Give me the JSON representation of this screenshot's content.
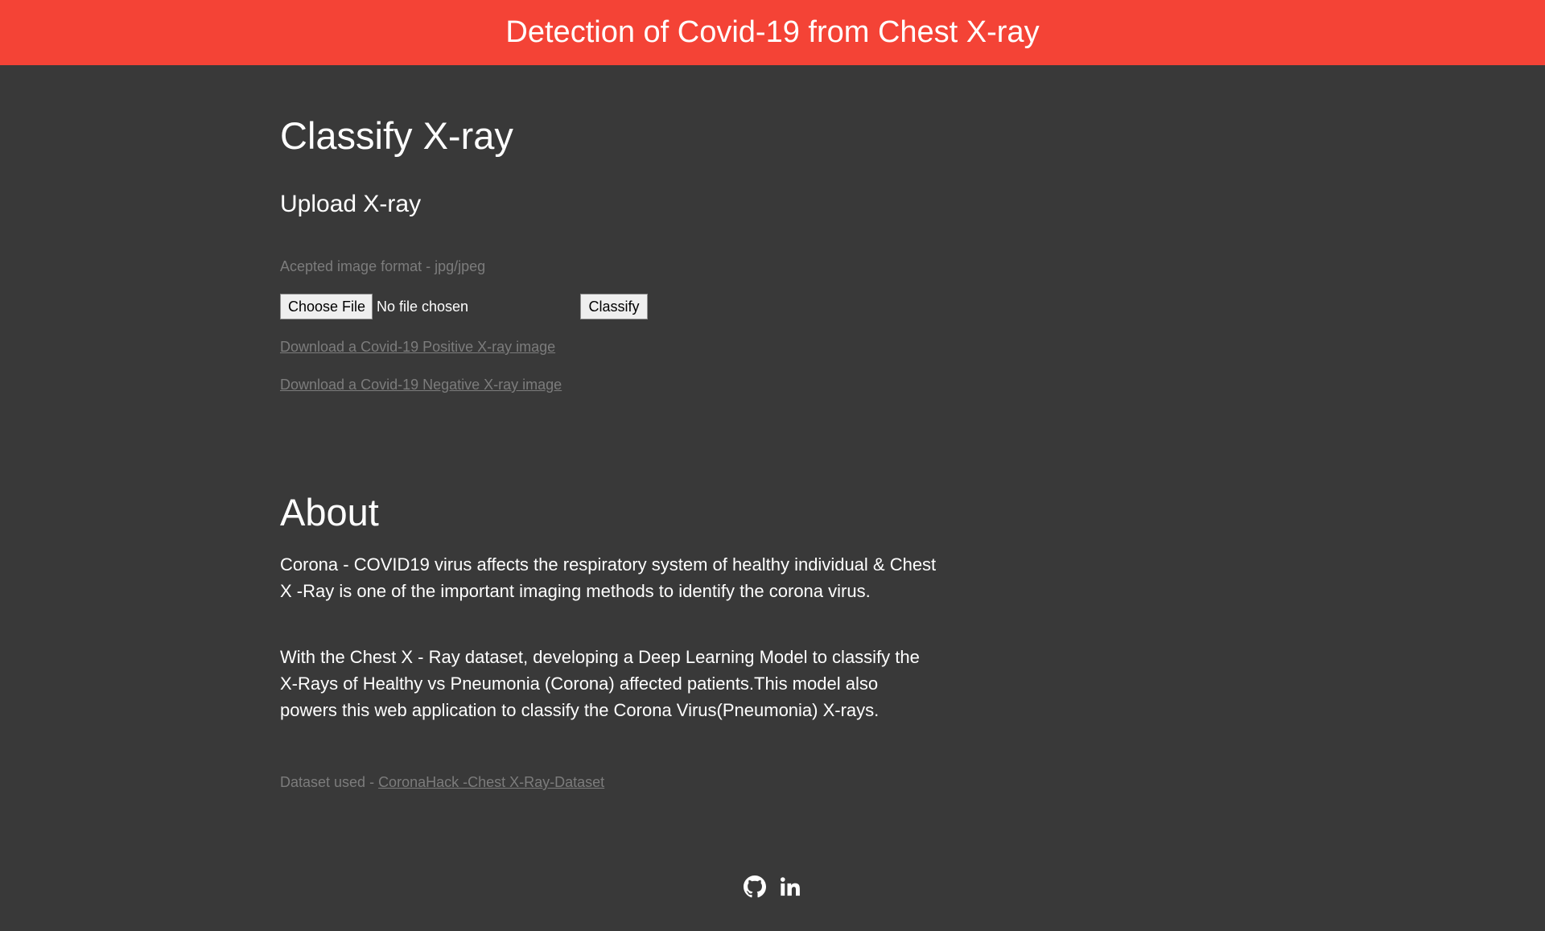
{
  "header": {
    "title": "Detection of Covid-19 from Chest X-ray",
    "bg_color": "#f44336"
  },
  "classify": {
    "heading": "Classify X-ray",
    "subheading": "Upload X-ray",
    "format_note": "Acepted image format - jpg/jpeg",
    "choose_file_label": "Choose File",
    "file_status": "No file chosen",
    "classify_button": "Classify",
    "download_positive": "Download a Covid-19 Positive X-ray image",
    "download_negative": "Download a Covid-19 Negative X-ray image"
  },
  "about": {
    "heading": "About",
    "paragraph1": "Corona - COVID19 virus affects the respiratory system of healthy individual & Chest X -Ray is one of the important imaging methods to identify the corona virus.",
    "paragraph2": "With the Chest X - Ray dataset, developing a Deep Learning Model to classify the X-Rays of Healthy vs Pneumonia (Corona) affected patients.This model also powers this web application to classify the Corona Virus(Pneumonia) X-rays.",
    "dataset_prefix": "Dataset used - ",
    "dataset_link": "CoronaHack -Chest X-Ray-Dataset"
  },
  "footer": {
    "icons": [
      "github-icon",
      "linkedin-icon"
    ]
  },
  "colors": {
    "background": "#393939",
    "muted_text": "#7c7c7c",
    "text": "#ffffff"
  }
}
